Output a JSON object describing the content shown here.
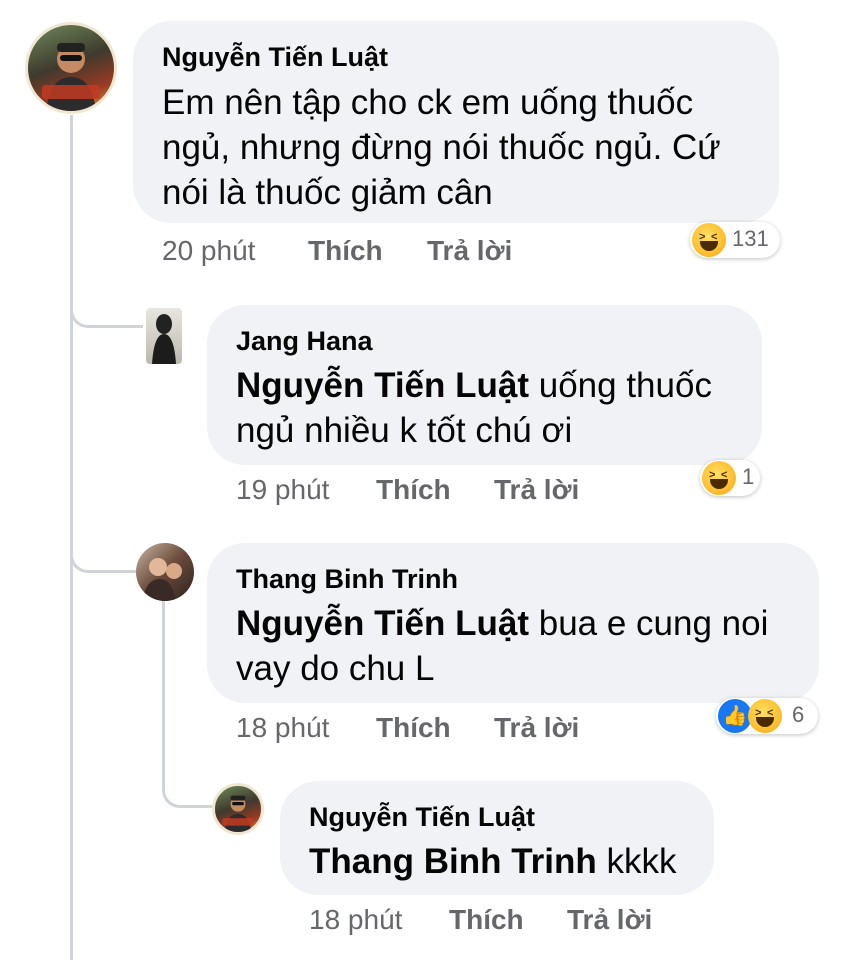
{
  "comments": [
    {
      "author": "Nguyễn Tiến Luật",
      "lines": [
        "Em nên tập cho ck em uống thuốc",
        "ngủ, nhưng đừng nói thuốc ngủ. Cứ",
        "nói là thuốc giảm cân"
      ],
      "time": "20 phút",
      "like_label": "Thích",
      "reply_label": "Trả lời",
      "reaction_count": "131",
      "reactions": [
        "haha-icon"
      ]
    },
    {
      "author": "Jang Hana",
      "mention": "Nguyễn Tiến Luật",
      "lines": [
        "uống thuốc",
        "ngủ nhiều k tốt chú ơi"
      ],
      "time": "19 phút",
      "like_label": "Thích",
      "reply_label": "Trả lời",
      "reaction_count": "1",
      "reactions": [
        "haha-icon"
      ]
    },
    {
      "author": "Thang Binh Trinh",
      "mention": "Nguyễn Tiến Luật",
      "lines": [
        "bua e cung noi",
        "vay do chu L"
      ],
      "time": "18 phút",
      "like_label": "Thích",
      "reply_label": "Trả lời",
      "reaction_count": "6",
      "reactions": [
        "like-icon",
        "haha-icon"
      ]
    },
    {
      "author": "Nguyễn Tiến Luật",
      "mention": "Thang Binh Trinh",
      "lines": [
        "kkkk"
      ],
      "time": "18 phút",
      "like_label": "Thích",
      "reply_label": "Trả lời"
    }
  ],
  "colors": {
    "bubble": "#f0f2f5",
    "meta": "#65676b",
    "like_blue": "#1877f2"
  }
}
